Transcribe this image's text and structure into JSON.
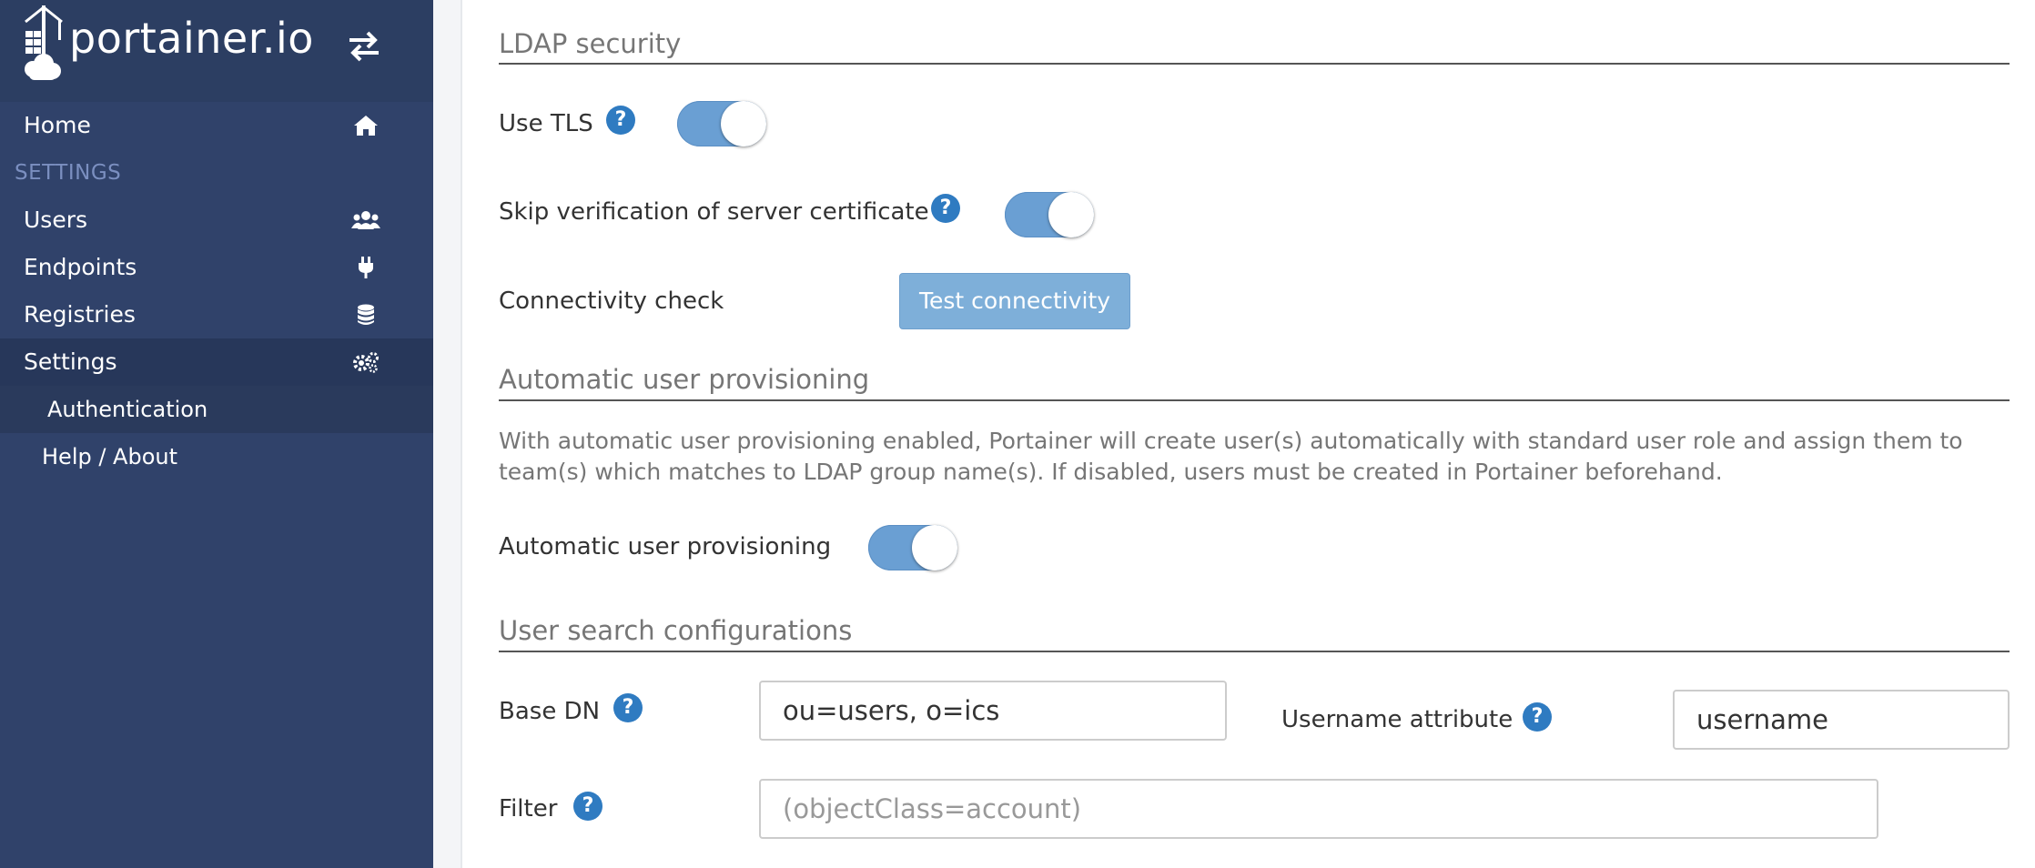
{
  "brand": {
    "logo_text": "portainer.io"
  },
  "sidebar": {
    "items": [
      {
        "label": "Home",
        "icon": "home-icon"
      },
      {
        "label": "Users",
        "icon": "users-icon"
      },
      {
        "label": "Endpoints",
        "icon": "plug-icon"
      },
      {
        "label": "Registries",
        "icon": "database-icon"
      },
      {
        "label": "Settings",
        "icon": "cogs-icon"
      }
    ],
    "section_heading": "SETTINGS",
    "sub_items": [
      {
        "label": "Authentication",
        "active": true
      },
      {
        "label": "Help / About"
      }
    ]
  },
  "ldap_security": {
    "title": "LDAP security",
    "use_tls_label": "Use TLS",
    "use_tls_enabled": true,
    "skip_verify_label": "Skip verification of server certificate",
    "skip_verify_enabled": true,
    "connectivity_label": "Connectivity check",
    "test_button_label": "Test connectivity"
  },
  "provisioning": {
    "title": "Automatic user provisioning",
    "description": "With automatic user provisioning enabled, Portainer will create user(s) automatically with standard user role and assign them to team(s) which matches to LDAP group name(s). If disabled, users must be created in Portainer beforehand.",
    "toggle_label": "Automatic user provisioning",
    "enabled": true
  },
  "user_search": {
    "title": "User search configurations",
    "base_dn_label": "Base DN",
    "base_dn_value": "ou=users, o=ics",
    "username_attr_label": "Username attribute",
    "username_attr_value": "username",
    "filter_label": "Filter",
    "filter_placeholder": "(objectClass=account)"
  },
  "help_glyph": "?",
  "colors": {
    "sidebar_bg": "#30426a",
    "accent": "#2f7bc1",
    "switch_on": "#6a9fd3",
    "button_bg": "#7eafd9"
  }
}
